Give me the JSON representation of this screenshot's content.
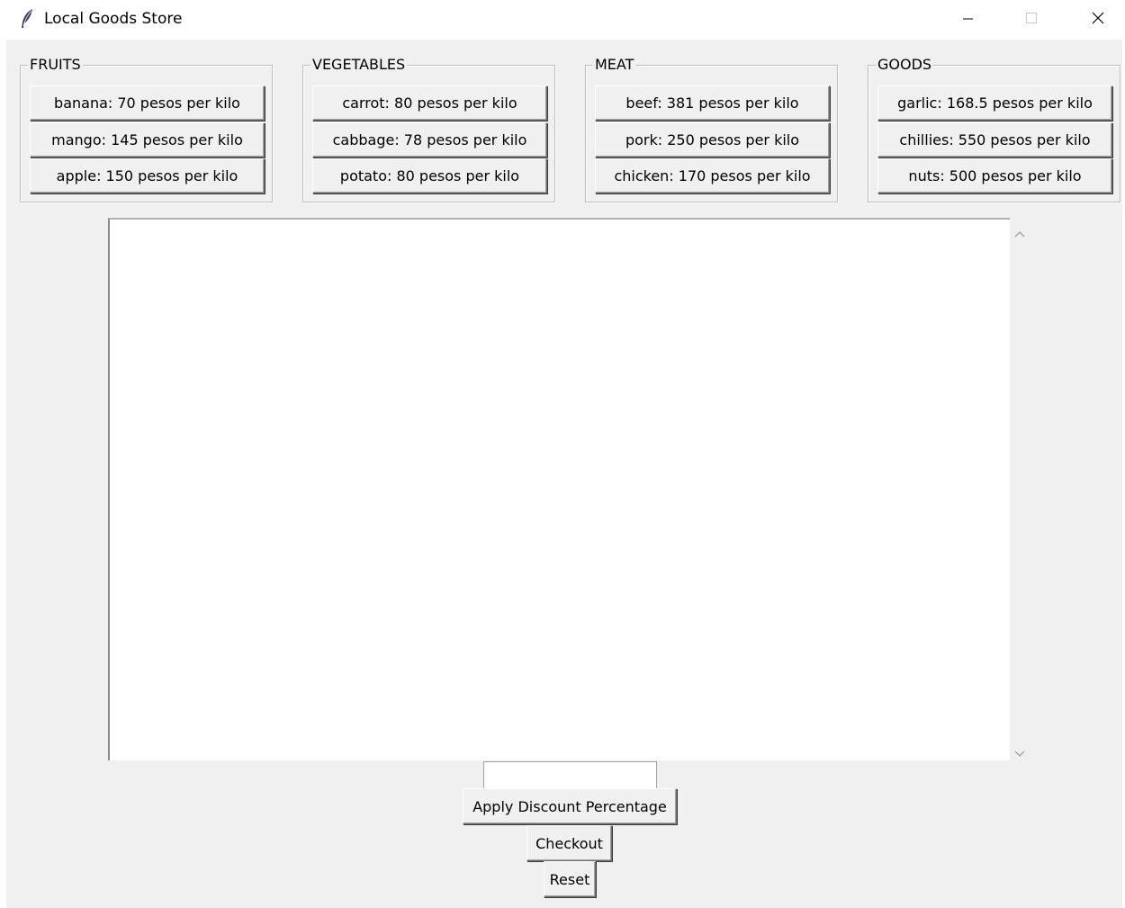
{
  "window": {
    "title": "Local Goods Store",
    "icon": "feather-icon",
    "controls": [
      "minimize-icon",
      "maximize-icon",
      "close-icon"
    ]
  },
  "groups": [
    {
      "title": "FRUITS",
      "items": [
        "banana: 70 pesos per kilo",
        "mango: 145 pesos per kilo",
        "apple: 150 pesos per kilo"
      ]
    },
    {
      "title": "VEGETABLES",
      "items": [
        "carrot: 80 pesos per kilo",
        "cabbage: 78 pesos per kilo",
        "potato: 80 pesos per kilo"
      ]
    },
    {
      "title": "MEAT",
      "items": [
        "beef: 381 pesos per kilo",
        "pork: 250 pesos per kilo",
        "chicken: 170 pesos per kilo"
      ]
    },
    {
      "title": "GOODS",
      "items": [
        "garlic: 168.5 pesos per kilo",
        "chillies: 550 pesos per kilo",
        "nuts: 500 pesos per kilo"
      ]
    }
  ],
  "cart": {
    "text": ""
  },
  "discount": {
    "value": "",
    "apply_label": "Apply Discount Percentage"
  },
  "actions": {
    "checkout_label": "Checkout",
    "reset_label": "Reset"
  }
}
